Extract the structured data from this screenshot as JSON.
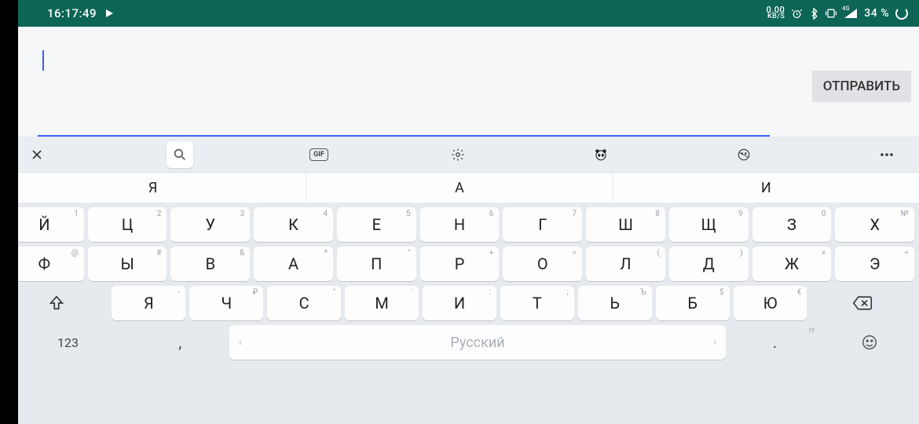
{
  "status": {
    "time": "16:17:49",
    "kbs_value": "0.00",
    "kbs_label": "KB/S",
    "network": "4G",
    "battery": "34 %"
  },
  "input": {
    "value": "",
    "placeholder": ""
  },
  "send_button": "ОТПРАВИТЬ",
  "toolbar": {
    "gif_label": "GIF"
  },
  "suggestions": [
    "Я",
    "А",
    "И"
  ],
  "keys": {
    "row1": [
      {
        "m": "Й",
        "a": "1"
      },
      {
        "m": "Ц",
        "a": "2"
      },
      {
        "m": "У",
        "a": "3"
      },
      {
        "m": "К",
        "a": "4"
      },
      {
        "m": "Е",
        "a": "5"
      },
      {
        "m": "Н",
        "a": "6"
      },
      {
        "m": "Г",
        "a": "7"
      },
      {
        "m": "Ш",
        "a": "8"
      },
      {
        "m": "Щ",
        "a": "9"
      },
      {
        "m": "З",
        "a": "0"
      },
      {
        "m": "Х",
        "a": "№"
      }
    ],
    "row2": [
      {
        "m": "Ф",
        "a": "@"
      },
      {
        "m": "Ы",
        "a": "#"
      },
      {
        "m": "В",
        "a": "&"
      },
      {
        "m": "А",
        "a": "*"
      },
      {
        "m": "П",
        "a": "\""
      },
      {
        "m": "Р",
        "a": "+"
      },
      {
        "m": "О",
        "a": "="
      },
      {
        "m": "Л",
        "a": "("
      },
      {
        "m": "Д",
        "a": ")"
      },
      {
        "m": "Ж",
        "a": "×"
      },
      {
        "m": "Э",
        "a": "÷"
      }
    ],
    "row3": [
      {
        "m": "Я",
        "a": "-"
      },
      {
        "m": "Ч",
        "a": "₽"
      },
      {
        "m": "С",
        "a": "\""
      },
      {
        "m": "М",
        "a": "'"
      },
      {
        "m": "И",
        "a": ":"
      },
      {
        "m": "Т",
        "a": ";"
      },
      {
        "m": "Ь",
        "a": "Ъ"
      },
      {
        "m": "Б",
        "a": "$"
      },
      {
        "m": "Ю",
        "a": "€"
      }
    ],
    "num_key": "123",
    "comma": ",",
    "period": ".",
    "period_alt": "!?",
    "space_label": "Русский"
  }
}
